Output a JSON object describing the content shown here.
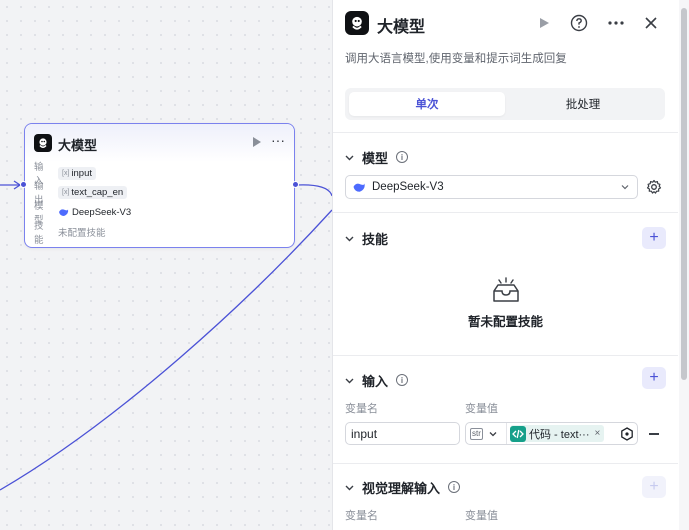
{
  "node": {
    "title": "大模型",
    "rows": [
      {
        "key": "输入",
        "value": "input",
        "kind": "var"
      },
      {
        "key": "输出",
        "value": "text_cap_en",
        "kind": "var"
      },
      {
        "key": "模型",
        "value": "DeepSeek-V3",
        "kind": "model"
      },
      {
        "key": "技能",
        "value": "未配置技能",
        "kind": "empty"
      }
    ],
    "var_icon": "[x]"
  },
  "panel": {
    "title": "大模型",
    "description": "调用大语言模型,使用变量和提示词生成回复",
    "tabs": [
      {
        "label": "单次",
        "active": true
      },
      {
        "label": "批处理",
        "active": false
      }
    ],
    "model_section": {
      "title": "模型",
      "info": "i",
      "selected_model": "DeepSeek-V3"
    },
    "skills_section": {
      "title": "技能",
      "empty_text": "暂未配置技能"
    },
    "input_section": {
      "title": "输入",
      "info": "i",
      "col_name": "变量名",
      "col_value": "变量值",
      "rows": [
        {
          "name": "input",
          "type": "str",
          "ref_label": "代码 - text···"
        }
      ]
    },
    "vision_section": {
      "title": "视觉理解输入",
      "info": "i",
      "col_name": "变量名",
      "col_value": "变量值"
    }
  },
  "colors": {
    "accent": "#4b52d6",
    "node_border": "#7b82ee",
    "code_chip": "#16a08a"
  }
}
